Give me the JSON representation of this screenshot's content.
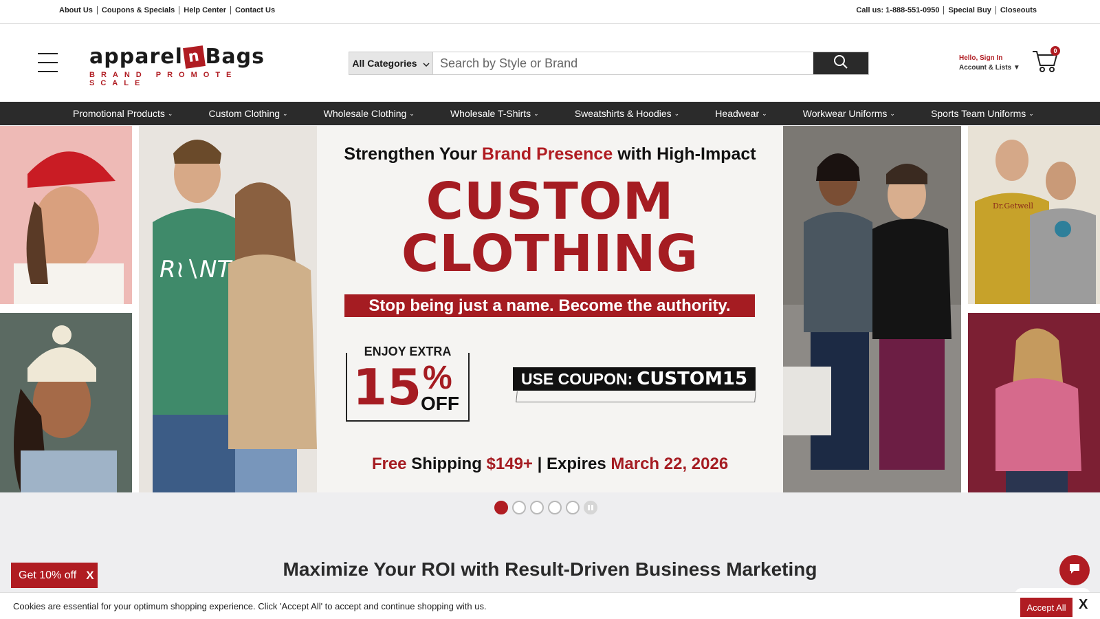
{
  "topbar": {
    "links_left": [
      "About Us",
      "Coupons & Specials",
      "Help Center",
      "Contact Us"
    ],
    "call": "Call us: 1-888-551-0950",
    "special_buy": "Special Buy",
    "closeouts": "Closeouts"
  },
  "header": {
    "logo_word_1": "apparel",
    "logo_n": "n",
    "logo_word_2": "Bags",
    "logo_tagline": "BRAND PROMOTE SCALE",
    "search": {
      "category": "All Categories",
      "placeholder": "Search by Style or Brand"
    },
    "account_hello": "Hello, Sign In",
    "account_lists": "Account & Lists",
    "cart_count": "0"
  },
  "nav": {
    "items": [
      "Promotional Products",
      "Custom Clothing",
      "Wholesale Clothing",
      "Wholesale T-Shirts",
      "Sweatshirts & Hoodies",
      "Headwear",
      "Workwear Uniforms",
      "Sports Team Uniforms"
    ]
  },
  "hero": {
    "headline_pre": "Strengthen Your",
    "headline_red": "Brand Presence",
    "headline_post": "with High-Impact",
    "big_line_1": "CUSTOM",
    "big_line_2": "CLOTHING",
    "tagline": "Stop being just a name. Become the authority.",
    "enjoy": "ENJOY EXTRA",
    "discount_number": "15",
    "discount_pct": "%",
    "discount_off": "OFF",
    "coupon_label": "USE COUPON:",
    "coupon_code": "CUSTOM15",
    "ship_free": "Free",
    "ship_text": "Shipping",
    "ship_amount": "$149+",
    "ship_sep": "|",
    "ship_expires": "Expires",
    "ship_date": "March 22, 2026"
  },
  "carousel": {
    "slides": 5,
    "active": 1
  },
  "section_title": "Maximize Your ROI with Result-Driven Business Marketing",
  "promo": {
    "label": "Get 10% off",
    "close": "X"
  },
  "cookie": {
    "message": "Cookies are essential for your optimum shopping experience. Click 'Accept All' to accept and continue shopping with us.",
    "accept": "Accept All",
    "close": "X"
  },
  "colors": {
    "brand_red": "#b01c22",
    "nav_bg": "#2b2b2b"
  }
}
